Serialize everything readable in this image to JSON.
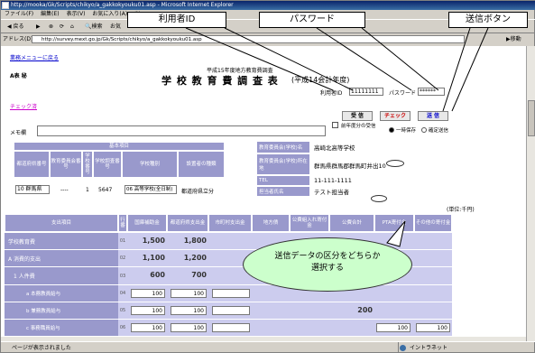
{
  "window": {
    "title": "http://mooka/Gk/Scripts/chikyo/a_gakkokyouku01.asp - Microsoft Internet Explorer"
  },
  "menu": [
    "ファイル(F)",
    "編集(E)",
    "表示(V)",
    "お気に入り(A)",
    "ツー"
  ],
  "toolbar": {
    "back": "戻る",
    "search": "検索",
    "favorites": "お気"
  },
  "address": {
    "label": "アドレス(D)",
    "url": "http://survey.mext.go.jp/Gk/Scripts/chikyo/a_gakkokyouku01.asp",
    "go": "移動"
  },
  "callouts": {
    "user_id": "利用者ID",
    "password": "パスワード",
    "send_button": "送信ボタン",
    "note_line1": "送信データの区分をどちらか",
    "note_line2": "選択する"
  },
  "page": {
    "menu_link": "業務メニューに戻る",
    "code": "A表 秘",
    "subtitle": "平成15年度地方教育費調査",
    "title": "学 校 教 育 費 調 査 表",
    "title_suffix": "(平成14会計年度)",
    "user_label": "利用者ID",
    "user_value": "11111111",
    "password_label": "パスワード",
    "password_value": "******",
    "check_link": "チェック済",
    "buttons": {
      "accept": "受 信",
      "check": "チェック",
      "send": "送 信"
    },
    "memo_label": "メモ欄",
    "prev_year": "前年度分の受信",
    "radio_temp": "一時保存",
    "radio_final": "確定送信"
  },
  "basic": {
    "heading": "基本項目",
    "headers": [
      "都道府県番号",
      "教育委員会番号",
      "学校番号",
      "学校調査番号",
      "学校種別",
      "設置者の種類"
    ],
    "values": {
      "pref": "10 群馬県",
      "board": "----",
      "school_no": "1",
      "survey_no": "5647",
      "school_type": "06 高等学校(全日制)",
      "founder": "都道府県立分"
    }
  },
  "info": {
    "board_label": "教育委員会(学校)名",
    "board_value": "高崎北高等学校",
    "addr_label": "教育委員会(学校)所在地",
    "addr_value": "群馬県群馬郡群馬町井出10",
    "tel_label": "TEL",
    "tel_value": "11-111-1111",
    "person_label": "担当者氏名",
    "person_value": "テスト担当者",
    "unit": "(単位:千円)"
  },
  "expense": {
    "col_headers": [
      "支出項目",
      "行番",
      "国庫補助金",
      "都道府県支出金",
      "市町村支出金",
      "地方債",
      "公費組入れ寄付金",
      "公費合計",
      "PTA寄付金",
      "その他の寄付金"
    ],
    "rows": [
      {
        "label": "学校教育費",
        "num": "01",
        "v1": "1,500",
        "v2": "1,800"
      },
      {
        "label": "A 消費的支出",
        "num": "02",
        "v1": "1,100",
        "v2": "1,200"
      },
      {
        "label": "1 人件費",
        "num": "03",
        "v1": "600",
        "v2": "700"
      },
      {
        "label": "a 本務教員給与",
        "num": "04",
        "i1": "100",
        "i2": "100"
      },
      {
        "label": "b 兼務教員給与",
        "num": "05",
        "i1": "100",
        "i2": "100",
        "total": "200"
      },
      {
        "label": "c 事務職員給与",
        "num": "06",
        "i1": "100",
        "i2": "100",
        "pta": "100",
        "other": "100"
      }
    ]
  },
  "status": {
    "text": "ページが表示されました",
    "zone": "イントラネット"
  }
}
